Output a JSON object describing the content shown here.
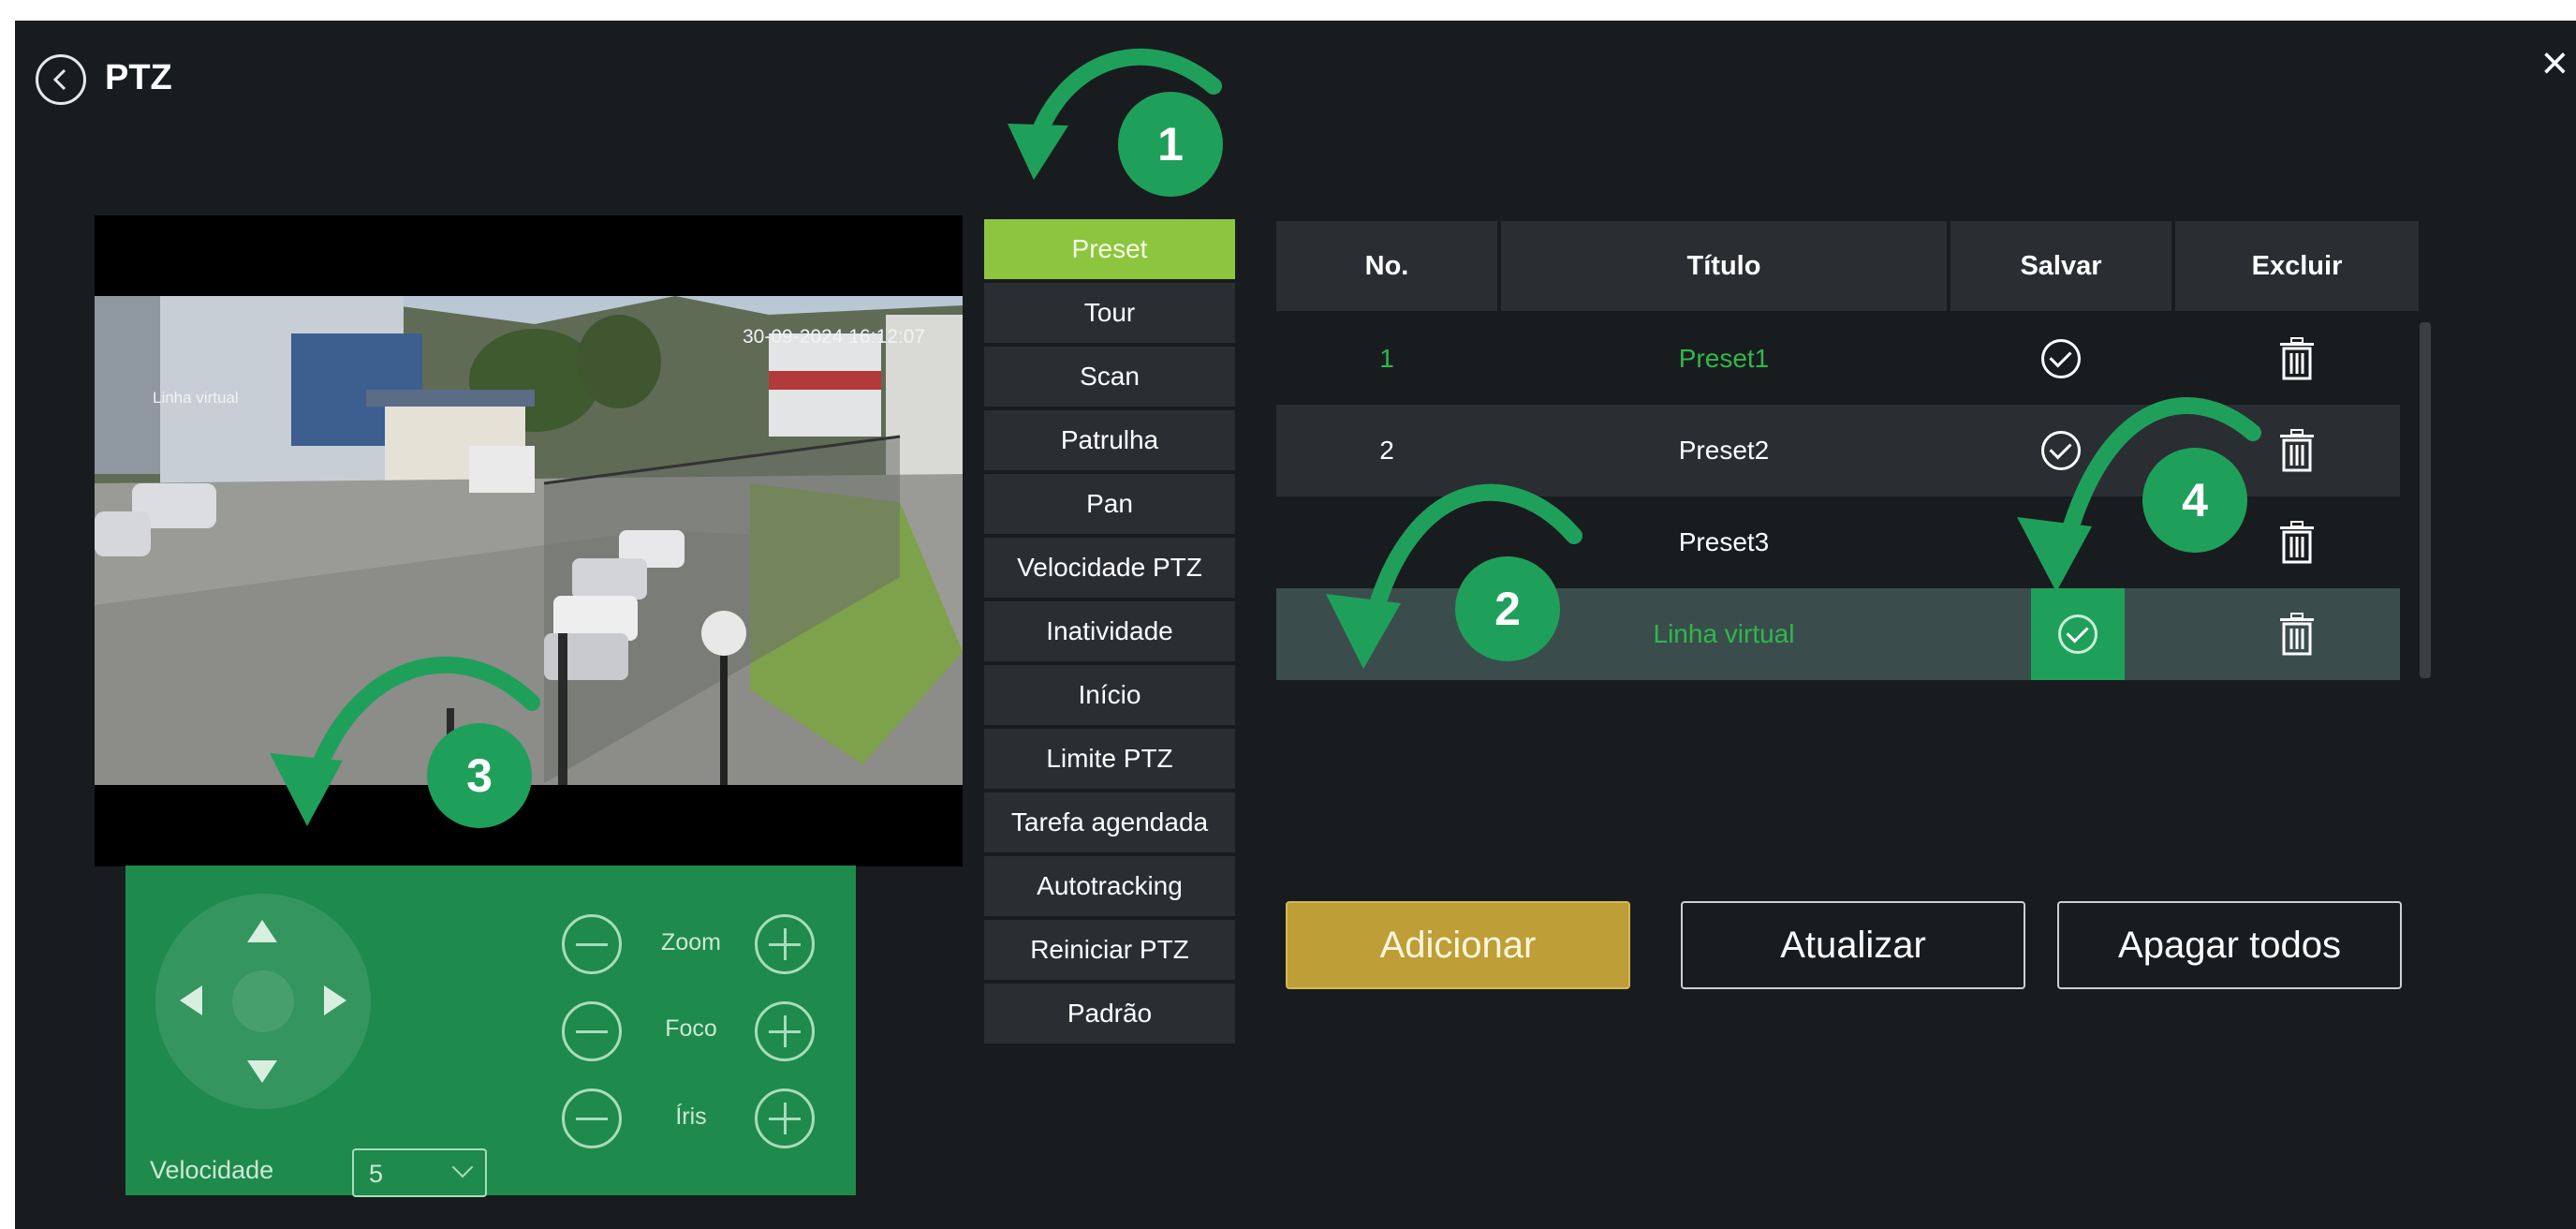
{
  "window": {
    "title": "PTZ",
    "close_glyph": "×"
  },
  "video": {
    "osd_time": "30-09-2024 16:12:07",
    "osd_name": "Linha virtual"
  },
  "ptz_controls": {
    "zoom_label": "Zoom",
    "focus_label": "Foco",
    "iris_label": "Íris",
    "speed_label": "Velocidade",
    "speed_value": "5"
  },
  "menu": {
    "items": [
      {
        "label": "Preset",
        "active": true
      },
      {
        "label": "Tour",
        "active": false
      },
      {
        "label": "Scan",
        "active": false
      },
      {
        "label": "Patrulha",
        "active": false
      },
      {
        "label": "Pan",
        "active": false
      },
      {
        "label": "Velocidade PTZ",
        "active": false
      },
      {
        "label": "Inatividade",
        "active": false
      },
      {
        "label": "Início",
        "active": false
      },
      {
        "label": "Limite PTZ",
        "active": false
      },
      {
        "label": "Tarefa agendada",
        "active": false
      },
      {
        "label": "Autotracking",
        "active": false
      },
      {
        "label": "Reiniciar PTZ",
        "active": false
      },
      {
        "label": "Padrão",
        "active": false
      }
    ]
  },
  "preset_table": {
    "columns": [
      "No.",
      "Título",
      "Salvar",
      "Excluir"
    ],
    "rows": [
      {
        "no": "1",
        "title": "Preset1",
        "state": "current"
      },
      {
        "no": "2",
        "title": "Preset2",
        "state": "normal"
      },
      {
        "no": "",
        "title": "Preset3",
        "state": "normal"
      },
      {
        "no": "",
        "title": "Linha virtual",
        "state": "selected"
      }
    ]
  },
  "buttons": {
    "add": "Adicionar",
    "refresh": "Atualizar",
    "delete_all": "Apagar todos"
  },
  "annotations": {
    "step1": "1",
    "step2": "2",
    "step3": "3",
    "step4": "4",
    "color": "#1fa05a"
  },
  "colors": {
    "background": "#191c1f",
    "active_menu": "#8cc63f",
    "ptz_panel": "#1e8a4c",
    "add_button": "#bd9e37",
    "current_text": "#2fb84a"
  }
}
